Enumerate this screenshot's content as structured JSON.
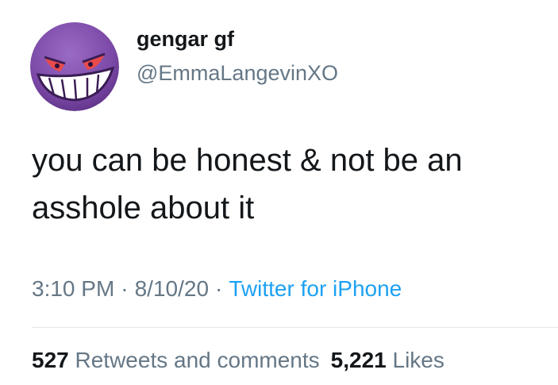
{
  "user": {
    "display_name": "gengar gf",
    "handle": "@EmmaLangevinXO",
    "avatar_icon": "gengar-avatar-icon",
    "avatar_bg": "#7e4ea8"
  },
  "tweet": {
    "text_line1": "you can be honest & not be an",
    "text_line2": "asshole about it"
  },
  "meta": {
    "time": "3:10 PM",
    "separator": "·",
    "date": "8/10/20",
    "source": "Twitter for iPhone"
  },
  "stats": {
    "retweets_count": "527",
    "retweets_label": "Retweets and comments",
    "likes_count": "5,221",
    "likes_label": "Likes"
  },
  "colors": {
    "text": "#14171a",
    "secondary": "#657786",
    "link": "#1da1f2",
    "divider": "#e1e8ed"
  }
}
